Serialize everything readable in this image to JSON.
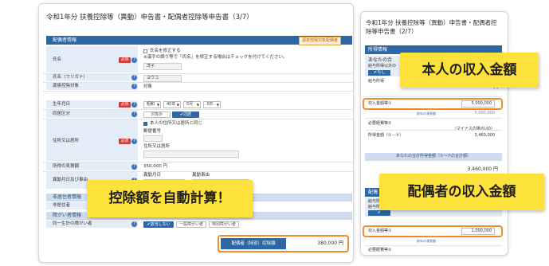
{
  "main": {
    "title": "令和1年分 扶養控除等（異動）申告書・配偶者控除等申告書（3/7）",
    "section": "配偶者情報",
    "section_badge": "源泉控除対象配偶者",
    "rows": {
      "name": {
        "label": "氏名",
        "checkbox": "氏名を修正する",
        "note": "※漢字の誤り等で「氏名」を修正する場合はチェックを付けてください。",
        "value": "洋子"
      },
      "kana": {
        "label": "氏名（フリガナ）",
        "value": "ヨウコ"
      },
      "deduction": {
        "label": "源泉控除対象",
        "value": "対象"
      },
      "birth": {
        "label": "生年月日",
        "era": "昭和",
        "year": "40年",
        "month": "5月",
        "day": "3日"
      },
      "cohabit": {
        "label": "同居区分",
        "opt1": "対象外",
        "opt2": "同居"
      },
      "address": {
        "label": "住所又は居所",
        "checkbox": "本人の住所又は居所と同じ",
        "postal_label": "郵便番号",
        "addr_label": "住所又は居所"
      },
      "income": {
        "label": "所得の見積額",
        "value": "350,000 円"
      },
      "change": {
        "label": "異動月日及び事由",
        "sub1": "異動月日",
        "sub2": "異動事由"
      }
    },
    "nonresident": {
      "label": "非居住者情報",
      "sub": "非居住者"
    },
    "disability": {
      "label": "障がい者情報",
      "sub": "同一生計の障がい者",
      "btn1": "該当しない",
      "btn2": "一般障がい者",
      "btn3": "特別障がい者"
    },
    "total": {
      "label": "配偶者（特別）控除額",
      "value": "380,000 円"
    }
  },
  "panel": {
    "title": "令和1年分 扶養控除等（異動）申告書・配偶者控除等申告書（2/7）",
    "section1": "所得情報",
    "sub1_label": "あなたの合",
    "sub1_note": "給与所得以外の",
    "sub1_btn": "なし",
    "salary_label": "給与所得",
    "salary_unit": "円",
    "income_label": "収入金額等①",
    "income_value": "5,000,000",
    "income_note": "前年の源泉額",
    "income_prev": "5,000,000",
    "expense_label": "必要経費等②",
    "income_amount_label": "所得金額（①－②）",
    "minus_note": "（マイナスの場合は0）",
    "minus_value": "3,460,000",
    "total_bar": "あなたの合計所得金額（①～⑦の合計額）",
    "total_value": "3,460,000 円",
    "section2": "配偶",
    "sub2_label": "給与所得",
    "sub2_note": "給与所得以外の",
    "spouse_income_label": "収入金額等①",
    "spouse_income_value": "1,000,000",
    "spouse_note": "前年の源泉額",
    "spouse_expense_label": "必要経費等②"
  },
  "callouts": {
    "self_income": "本人の収入金額",
    "auto_calc": "控除額を自動計算！",
    "spouse_income": "配偶者の収入金額"
  },
  "colors": {
    "accent": "#2d67a6",
    "callout": "#fde23c",
    "highlight": "#ef8b2c",
    "required": "#d63a3a"
  }
}
